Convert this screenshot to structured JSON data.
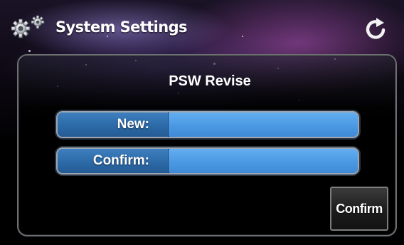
{
  "header": {
    "title": "System Settings",
    "left_icon": "gear-icon",
    "right_icon": "refresh-icon"
  },
  "panel": {
    "title": "PSW Revise",
    "fields": [
      {
        "label": "New:",
        "value": ""
      },
      {
        "label": "Confirm:",
        "value": ""
      }
    ],
    "confirm_button_label": "Confirm"
  },
  "colors": {
    "field_blue": "#4d9be4",
    "label_blue": "#2c6aa8",
    "background": "#000000",
    "text": "#ffffff"
  }
}
